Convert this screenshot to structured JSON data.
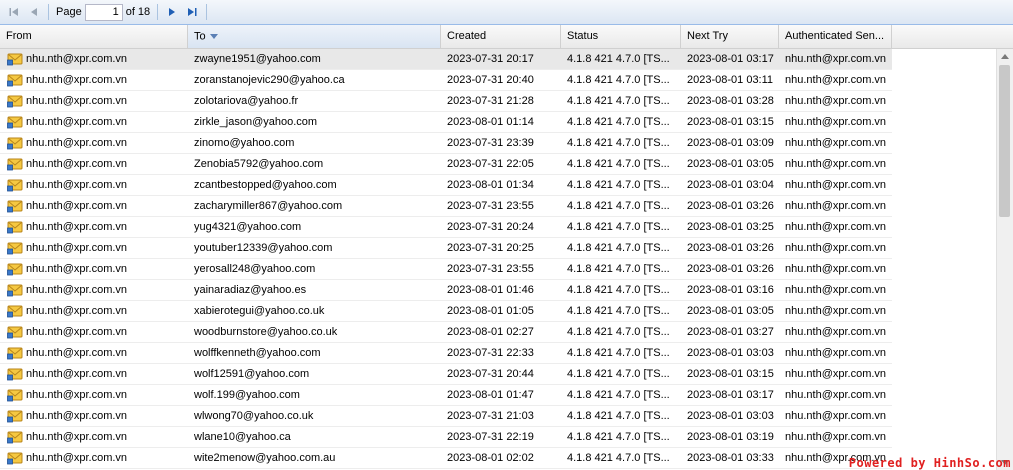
{
  "toolbar": {
    "page_label": "Page",
    "page_value": "1",
    "of_label": "of 18"
  },
  "columns": [
    "From",
    "To",
    "Created",
    "Status",
    "Next Try",
    "Authenticated Sen..."
  ],
  "rows": [
    [
      "nhu.nth@xpr.com.vn",
      "zwayne1951@yahoo.com",
      "2023-07-31 20:17",
      "4.1.8 421 4.7.0 [TS...",
      "2023-08-01 03:17",
      "nhu.nth@xpr.com.vn"
    ],
    [
      "nhu.nth@xpr.com.vn",
      "zoranstanojevic290@yahoo.ca",
      "2023-07-31 20:40",
      "4.1.8 421 4.7.0 [TS...",
      "2023-08-01 03:11",
      "nhu.nth@xpr.com.vn"
    ],
    [
      "nhu.nth@xpr.com.vn",
      "zolotariova@yahoo.fr",
      "2023-07-31 21:28",
      "4.1.8 421 4.7.0 [TS...",
      "2023-08-01 03:28",
      "nhu.nth@xpr.com.vn"
    ],
    [
      "nhu.nth@xpr.com.vn",
      "zirkle_jason@yahoo.com",
      "2023-08-01 01:14",
      "4.1.8 421 4.7.0 [TS...",
      "2023-08-01 03:15",
      "nhu.nth@xpr.com.vn"
    ],
    [
      "nhu.nth@xpr.com.vn",
      "zinomo@yahoo.com",
      "2023-07-31 23:39",
      "4.1.8 421 4.7.0 [TS...",
      "2023-08-01 03:09",
      "nhu.nth@xpr.com.vn"
    ],
    [
      "nhu.nth@xpr.com.vn",
      "Zenobia5792@yahoo.com",
      "2023-07-31 22:05",
      "4.1.8 421 4.7.0 [TS...",
      "2023-08-01 03:05",
      "nhu.nth@xpr.com.vn"
    ],
    [
      "nhu.nth@xpr.com.vn",
      "zcantbestopped@yahoo.com",
      "2023-08-01 01:34",
      "4.1.8 421 4.7.0 [TS...",
      "2023-08-01 03:04",
      "nhu.nth@xpr.com.vn"
    ],
    [
      "nhu.nth@xpr.com.vn",
      "zacharymiller867@yahoo.com",
      "2023-07-31 23:55",
      "4.1.8 421 4.7.0 [TS...",
      "2023-08-01 03:26",
      "nhu.nth@xpr.com.vn"
    ],
    [
      "nhu.nth@xpr.com.vn",
      "yug4321@yahoo.com",
      "2023-07-31 20:24",
      "4.1.8 421 4.7.0 [TS...",
      "2023-08-01 03:25",
      "nhu.nth@xpr.com.vn"
    ],
    [
      "nhu.nth@xpr.com.vn",
      "youtuber12339@yahoo.com",
      "2023-07-31 20:25",
      "4.1.8 421 4.7.0 [TS...",
      "2023-08-01 03:26",
      "nhu.nth@xpr.com.vn"
    ],
    [
      "nhu.nth@xpr.com.vn",
      "yerosall248@yahoo.com",
      "2023-07-31 23:55",
      "4.1.8 421 4.7.0 [TS...",
      "2023-08-01 03:26",
      "nhu.nth@xpr.com.vn"
    ],
    [
      "nhu.nth@xpr.com.vn",
      "yainaradiaz@yahoo.es",
      "2023-08-01 01:46",
      "4.1.8 421 4.7.0 [TS...",
      "2023-08-01 03:16",
      "nhu.nth@xpr.com.vn"
    ],
    [
      "nhu.nth@xpr.com.vn",
      "xabierotegui@yahoo.co.uk",
      "2023-08-01 01:05",
      "4.1.8 421 4.7.0 [TS...",
      "2023-08-01 03:05",
      "nhu.nth@xpr.com.vn"
    ],
    [
      "nhu.nth@xpr.com.vn",
      "woodburnstore@yahoo.co.uk",
      "2023-08-01 02:27",
      "4.1.8 421 4.7.0 [TS...",
      "2023-08-01 03:27",
      "nhu.nth@xpr.com.vn"
    ],
    [
      "nhu.nth@xpr.com.vn",
      "wolffkenneth@yahoo.com",
      "2023-07-31 22:33",
      "4.1.8 421 4.7.0 [TS...",
      "2023-08-01 03:03",
      "nhu.nth@xpr.com.vn"
    ],
    [
      "nhu.nth@xpr.com.vn",
      "wolf12591@yahoo.com",
      "2023-07-31 20:44",
      "4.1.8 421 4.7.0 [TS...",
      "2023-08-01 03:15",
      "nhu.nth@xpr.com.vn"
    ],
    [
      "nhu.nth@xpr.com.vn",
      "wolf.199@yahoo.com",
      "2023-08-01 01:47",
      "4.1.8 421 4.7.0 [TS...",
      "2023-08-01 03:17",
      "nhu.nth@xpr.com.vn"
    ],
    [
      "nhu.nth@xpr.com.vn",
      "wlwong70@yahoo.co.uk",
      "2023-07-31 21:03",
      "4.1.8 421 4.7.0 [TS...",
      "2023-08-01 03:03",
      "nhu.nth@xpr.com.vn"
    ],
    [
      "nhu.nth@xpr.com.vn",
      "wlane10@yahoo.ca",
      "2023-07-31 22:19",
      "4.1.8 421 4.7.0 [TS...",
      "2023-08-01 03:19",
      "nhu.nth@xpr.com.vn"
    ],
    [
      "nhu.nth@xpr.com.vn",
      "wite2menow@yahoo.com.au",
      "2023-08-01 02:02",
      "4.1.8 421 4.7.0 [TS...",
      "2023-08-01 03:33",
      "nhu.nth@xpr.com.vn"
    ]
  ],
  "row_icon": "envelope-queue-icon",
  "watermark": "Powered by HinhSo.com",
  "colors": {
    "toolbar_bg": "#dce6f3",
    "header_bg": "#e9e9e9",
    "selected_row": "#e8e8e8",
    "pager_arrow": "#1f5fb5",
    "watermark": "#e02020"
  }
}
